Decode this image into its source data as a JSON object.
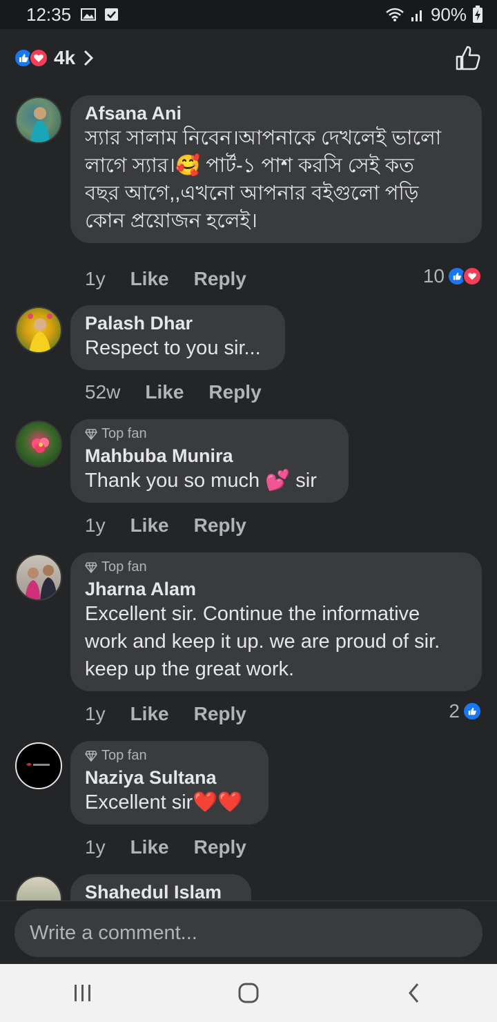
{
  "status_bar": {
    "time": "12:35",
    "battery": "90%"
  },
  "header": {
    "reaction_count": "4k"
  },
  "comments": [
    {
      "author": "Afsana Ani",
      "top_fan": false,
      "text_lines": [
        "স্যার সালাম নিবেন।আপনাকে দেখলেই ভালো",
        "লাগে স্যার।🥰 পার্ট-১ পাশ করসি সেই কত",
        "বছর আগে,,এখনো আপনার বইগুলো পড়ি",
        "কোন প্রয়োজন হলেই।"
      ],
      "time": "1y",
      "like_label": "Like",
      "reply_label": "Reply",
      "reactions": "10",
      "reaction_types": [
        "like",
        "love"
      ]
    },
    {
      "author": "Palash Dhar",
      "top_fan": false,
      "text_lines": [
        "Respect to you sir..."
      ],
      "time": "52w",
      "like_label": "Like",
      "reply_label": "Reply"
    },
    {
      "author": "Mahbuba Munira",
      "top_fan": true,
      "top_fan_label": "Top fan",
      "text_lines": [
        "Thank you so much 💕 sir"
      ],
      "time": "1y",
      "like_label": "Like",
      "reply_label": "Reply"
    },
    {
      "author": "Jharna Alam",
      "top_fan": true,
      "top_fan_label": "Top fan",
      "text_lines": [
        "Excellent sir. Continue the informative",
        "work and keep it up. we are proud of sir.",
        "keep up the great work."
      ],
      "time": "1y",
      "like_label": "Like",
      "reply_label": "Reply",
      "reactions": "2",
      "reaction_types": [
        "like"
      ]
    },
    {
      "author": "Naziya Sultana",
      "top_fan": true,
      "top_fan_label": "Top fan",
      "text_lines": [
        "Excellent sir❤️❤️"
      ],
      "time": "1y",
      "like_label": "Like",
      "reply_label": "Reply"
    },
    {
      "author": "Shahedul Islam",
      "top_fan": false,
      "text_lines": []
    }
  ],
  "composer": {
    "placeholder": "Write a comment..."
  },
  "colors": {
    "background": "#242526",
    "bubble": "#3a3b3c",
    "like_blue": "#1877f2",
    "love_red": "#f33e58",
    "secondary_text": "#b0b3b8"
  }
}
